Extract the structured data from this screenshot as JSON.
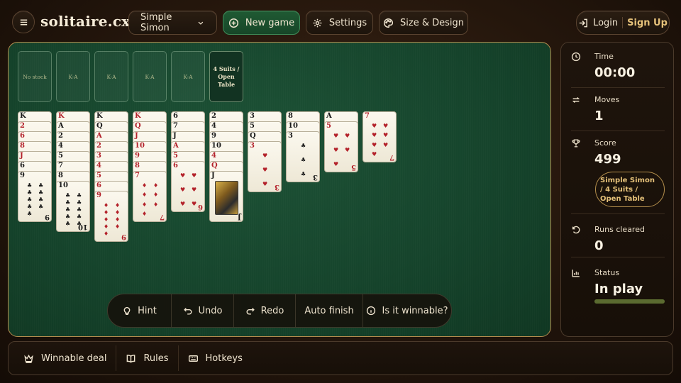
{
  "header": {
    "brand": "solitaire.cx",
    "variant": "Simple Simon",
    "new_game": "New game",
    "settings": "Settings",
    "size_design": "Size & Design",
    "login": "Login",
    "signup": "Sign Up"
  },
  "slots": [
    "No stock",
    "K-A",
    "K-A",
    "K-A",
    "K-A"
  ],
  "info_slot": "4 Suits / Open Table",
  "colors": {
    "red": "#b3212a",
    "black": "#1a1a1a",
    "felt": "#15432b",
    "accent": "#e6c27a"
  },
  "tableau": [
    [
      [
        "K",
        "♠",
        "black"
      ],
      [
        "2",
        "♥",
        "red"
      ],
      [
        "6",
        "♥",
        "red"
      ],
      [
        "8",
        "♥",
        "red"
      ],
      [
        "J",
        "♥",
        "red"
      ],
      [
        "6",
        "♠",
        "black"
      ],
      [
        "9",
        "♣",
        "black"
      ]
    ],
    [
      [
        "K",
        "♥",
        "red"
      ],
      [
        "A",
        "♠",
        "black"
      ],
      [
        "2",
        "♠",
        "black"
      ],
      [
        "4",
        "♣",
        "black"
      ],
      [
        "5",
        "♠",
        "black"
      ],
      [
        "7",
        "♠",
        "black"
      ],
      [
        "8",
        "♠",
        "black"
      ],
      [
        "10",
        "♣",
        "black"
      ]
    ],
    [
      [
        "K",
        "♠",
        "black"
      ],
      [
        "Q",
        "♠",
        "black"
      ],
      [
        "A",
        "♦",
        "red"
      ],
      [
        "2",
        "♦",
        "red"
      ],
      [
        "3",
        "♦",
        "red"
      ],
      [
        "4",
        "♦",
        "red"
      ],
      [
        "5",
        "♦",
        "red"
      ],
      [
        "6",
        "♦",
        "red"
      ],
      [
        "9",
        "♦",
        "red"
      ]
    ],
    [
      [
        "K",
        "♥",
        "red"
      ],
      [
        "Q",
        "♥",
        "red"
      ],
      [
        "J",
        "♦",
        "red"
      ],
      [
        "10",
        "♦",
        "red"
      ],
      [
        "9",
        "♦",
        "red"
      ],
      [
        "8",
        "♦",
        "red"
      ],
      [
        "7",
        "♦",
        "red"
      ]
    ],
    [
      [
        "6",
        "♠",
        "black"
      ],
      [
        "7",
        "♠",
        "black"
      ],
      [
        "J",
        "♠",
        "black"
      ],
      [
        "A",
        "♥",
        "red"
      ],
      [
        "5",
        "♥",
        "red"
      ],
      [
        "6",
        "♥",
        "red"
      ]
    ],
    [
      [
        "2",
        "♠",
        "black"
      ],
      [
        "4",
        "♠",
        "black"
      ],
      [
        "9",
        "♠",
        "black"
      ],
      [
        "10",
        "♠",
        "black"
      ],
      [
        "4",
        "♦",
        "red"
      ],
      [
        "Q",
        "♦",
        "red"
      ],
      [
        "J",
        "♣",
        "black"
      ]
    ],
    [
      [
        "3",
        "♠",
        "black"
      ],
      [
        "5",
        "♠",
        "black"
      ],
      [
        "Q",
        "♠",
        "black"
      ],
      [
        "3",
        "♥",
        "red"
      ]
    ],
    [
      [
        "8",
        "♠",
        "black"
      ],
      [
        "10",
        "♠",
        "black"
      ],
      [
        "3",
        "♣",
        "black"
      ]
    ],
    [
      [
        "A",
        "♠",
        "black"
      ],
      [
        "5",
        "♥",
        "red"
      ]
    ],
    [
      [
        "7",
        "♥",
        "red"
      ]
    ]
  ],
  "controls": {
    "hint": "Hint",
    "undo": "Undo",
    "redo": "Redo",
    "auto_finish": "Auto finish",
    "winnable": "Is it winnable?"
  },
  "sidebar": {
    "time_label": "Time",
    "time_value": "00:00",
    "moves_label": "Moves",
    "moves_value": "1",
    "score_label": "Score",
    "score_value": "499",
    "variant_pill": "Simple Simon / 4 Suits / Open Table",
    "runs_label": "Runs cleared",
    "runs_value": "0",
    "status_label": "Status",
    "status_value": "In play"
  },
  "footer": {
    "winnable": "Winnable deal",
    "rules": "Rules",
    "hotkeys": "Hotkeys"
  }
}
